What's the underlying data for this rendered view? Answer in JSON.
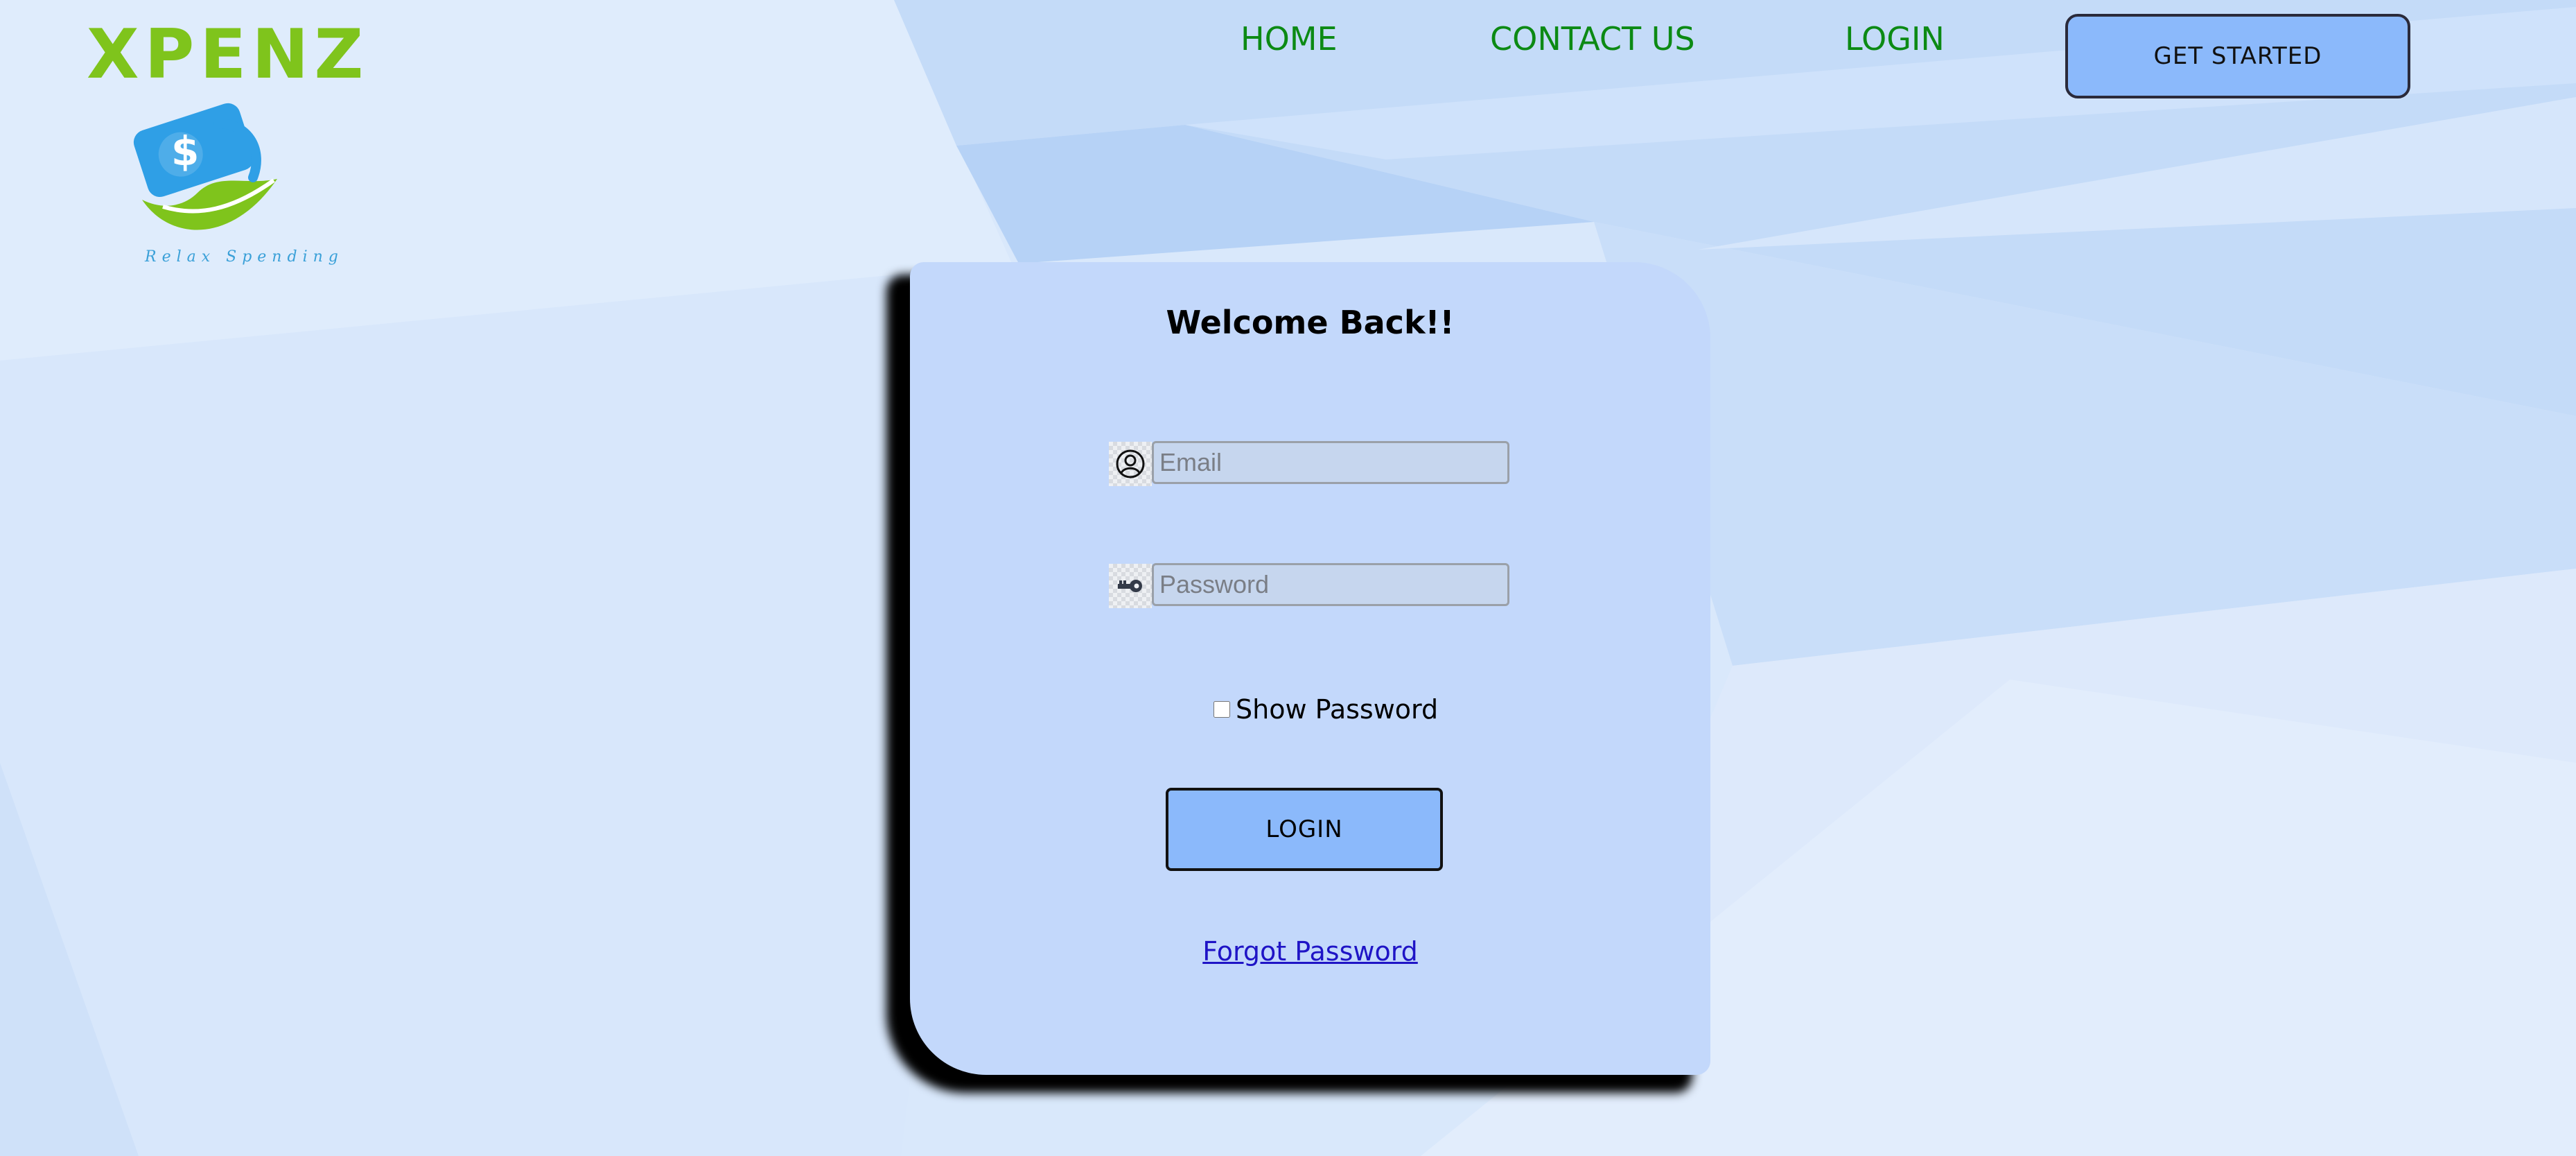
{
  "logo": {
    "wordmark": "XPENZ",
    "tagline": "Relax Spending",
    "icon_currency": "$"
  },
  "nav": {
    "items": [
      {
        "label": "HOME"
      },
      {
        "label": "CONTACT US"
      },
      {
        "label": "LOGIN"
      }
    ],
    "cta_label": "GET STARTED"
  },
  "login_form": {
    "title": "Welcome Back!!",
    "email": {
      "placeholder": "Email",
      "value": "",
      "icon": "user-circle-icon"
    },
    "password": {
      "placeholder": "Password",
      "value": "",
      "icon": "key-icon"
    },
    "show_password": {
      "label": "Show Password",
      "checked": false
    },
    "submit_label": "LOGIN",
    "forgot_label": "Forgot Password"
  },
  "colors": {
    "brand_green": "#7fc41c",
    "nav_green": "#0c8a14",
    "button_blue": "#8bb9fb",
    "card_bg": "#c3d8fb",
    "link_blue": "#1f14c6",
    "logo_blue": "#3aa0d8"
  }
}
